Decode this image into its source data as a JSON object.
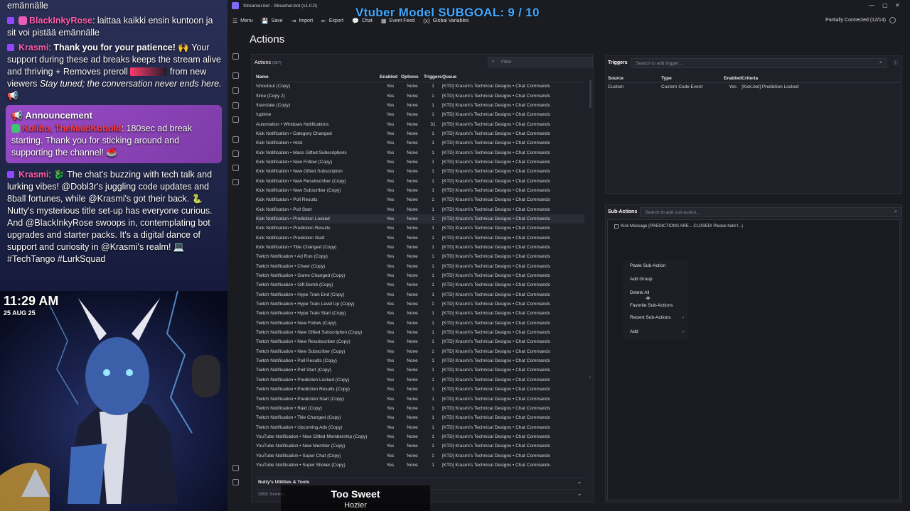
{
  "overlay": {
    "chat": [
      {
        "type": "text",
        "text": "emännälle"
      },
      {
        "type": "msg",
        "user": "BlackInkyRose",
        "user_class": "u-pink",
        "text": ": laittaa kaikki ensin kuntoon ja sit voi pistää emännälle"
      },
      {
        "type": "msg2",
        "user": "Krasmi",
        "user_class": "u-pink",
        "bold": "Thank you for your patience!",
        "text_a": " 🙌 Your support during these ad breaks keeps the stream alive and thriving + Removes preroll ",
        "text_b": " from new viewers ",
        "ital": "Stay tuned; the conversation never ends here.",
        "end": " 📢"
      },
      {
        "type": "announcement",
        "title": "Announcement",
        "user": "Kolibo, TheMaidKobold",
        "text": ": 180sec ad break starting. Thank you for sticking around and supporting the channel! 🥌"
      },
      {
        "type": "msg",
        "user": "Krasmi",
        "user_class": "u-pink",
        "text": ": 🐉 The chat's buzzing with tech talk and lurking vibes! @Dobl3r's juggling code updates and 8ball fortunes, while @Krasmi's got their back. 🐍 Nutty's mysterious title set-up has everyone curious. And @BlackInkyRose swoops in, contemplating bot upgrades and starter packs. It's a digital dance of support and curiosity in @Krasmi's realm! 💻 #TechTango #LurkSquad"
      }
    ],
    "clock": "11:29 AM",
    "date": "25 AUG 25",
    "song_title": "Too Sweet",
    "song_artist": "Hozier"
  },
  "app": {
    "window_title": "Streamer.bot - Streamer.bot (v1.0.0)",
    "subgoal": "Vtuber Model SUBGOAL: 9 / 10",
    "toolbar": [
      {
        "icon": "☰",
        "label": "Menu",
        "name": "menu"
      },
      {
        "icon": "💾",
        "label": "Save",
        "name": "save"
      },
      {
        "icon": "⇥",
        "label": "Import",
        "name": "import"
      },
      {
        "icon": "⇤",
        "label": "Export",
        "name": "export"
      },
      {
        "icon": "💬",
        "label": "Chat",
        "name": "chat"
      },
      {
        "icon": "▦",
        "label": "Event Feed",
        "name": "event-feed"
      },
      {
        "icon": "(x)",
        "label": "Global Variables",
        "name": "global-variables"
      }
    ],
    "connection_status": "Partially Connected (12/14)",
    "page_title": "Actions",
    "actions": {
      "heading": "Actions",
      "count": "(567)",
      "filter_placeholder": "Filter",
      "columns": [
        "Name",
        "Enabled",
        "Options",
        "Triggers",
        "Queue"
      ],
      "rows": [
        [
          "!shoutout (Copy)",
          "Yes",
          "None",
          "1",
          "[KTD] Krasmi's Technical Designs • Chat Commands"
        ],
        [
          "!time (Copy 2)",
          "Yes",
          "None",
          "1",
          "[KTD] Krasmi's Technical Designs • Chat Commands"
        ],
        [
          "!translate (Copy)",
          "Yes",
          "None",
          "1",
          "[KTD] Krasmi's Technical Designs • Chat Commands"
        ],
        [
          "!uptime",
          "Yes",
          "None",
          "1",
          "[KTD] Krasmi's Technical Designs • Chat Commands"
        ],
        [
          "Automation • Windows Notifications",
          "Yes",
          "None",
          "31",
          "[KTD] Krasmi's Technical Designs • Chat Commands"
        ],
        [
          "Kick Notification • Category Changed",
          "Yes",
          "None",
          "1",
          "[KTD] Krasmi's Technical Designs • Chat Commands"
        ],
        [
          "Kick Notification • Host",
          "Yes",
          "None",
          "1",
          "[KTD] Krasmi's Technical Designs • Chat Commands"
        ],
        [
          "Kick Notification • Mass Gifted Subscriptions",
          "Yes",
          "None",
          "1",
          "[KTD] Krasmi's Technical Designs • Chat Commands"
        ],
        [
          "Kick Notification • New Follow (Copy)",
          "Yes",
          "None",
          "1",
          "[KTD] Krasmi's Technical Designs • Chat Commands"
        ],
        [
          "Kick Notification • New Gifted Subscription",
          "Yes",
          "None",
          "1",
          "[KTD] Krasmi's Technical Designs • Chat Commands"
        ],
        [
          "Kick Notification • New Resubscriber (Copy)",
          "Yes",
          "None",
          "1",
          "[KTD] Krasmi's Technical Designs • Chat Commands"
        ],
        [
          "Kick Notification • New Subscriber (Copy)",
          "Yes",
          "None",
          "1",
          "[KTD] Krasmi's Technical Designs • Chat Commands"
        ],
        [
          "Kick Notification • Poll Results",
          "Yes",
          "None",
          "1",
          "[KTD] Krasmi's Technical Designs • Chat Commands"
        ],
        [
          "Kick Notification • Poll Start",
          "Yes",
          "None",
          "1",
          "[KTD] Krasmi's Technical Designs • Chat Commands"
        ],
        [
          "Kick Notification • Prediction Locked",
          "Yes",
          "None",
          "1",
          "[KTD] Krasmi's Technical Designs • Chat Commands"
        ],
        [
          "Kick Notification • Prediction Results",
          "Yes",
          "None",
          "1",
          "[KTD] Krasmi's Technical Designs • Chat Commands"
        ],
        [
          "Kick Notification • Prediction Start",
          "Yes",
          "None",
          "1",
          "[KTD] Krasmi's Technical Designs • Chat Commands"
        ],
        [
          "Kick Notification • Title Changed (Copy)",
          "Yes",
          "None",
          "1",
          "[KTD] Krasmi's Technical Designs • Chat Commands"
        ],
        [
          "Twitch Notification • Ad Run (Copy)",
          "Yes",
          "None",
          "1",
          "[KTD] Krasmi's Technical Designs • Chat Commands"
        ],
        [
          "Twitch Notification • Cheer (Copy)",
          "Yes",
          "None",
          "1",
          "[KTD] Krasmi's Technical Designs • Chat Commands"
        ],
        [
          "Twitch Notification • Game Changed (Copy)",
          "Yes",
          "None",
          "1",
          "[KTD] Krasmi's Technical Designs • Chat Commands"
        ],
        [
          "Twitch Notification • Gift Bomb (Copy)",
          "Yes",
          "None",
          "1",
          "[KTD] Krasmi's Technical Designs • Chat Commands"
        ],
        [
          "Twitch Notification • Hype Train End (Copy)",
          "Yes",
          "None",
          "1",
          "[KTD] Krasmi's Technical Designs • Chat Commands"
        ],
        [
          "Twitch Notification • Hype Train Level Up (Copy)",
          "Yes",
          "None",
          "1",
          "[KTD] Krasmi's Technical Designs • Chat Commands"
        ],
        [
          "Twitch Notification • Hype Train Start (Copy)",
          "Yes",
          "None",
          "1",
          "[KTD] Krasmi's Technical Designs • Chat Commands"
        ],
        [
          "Twitch Notification • New Follow (Copy)",
          "Yes",
          "None",
          "1",
          "[KTD] Krasmi's Technical Designs • Chat Commands"
        ],
        [
          "Twitch Notification • New Gifted Subscription (Copy)",
          "Yes",
          "None",
          "1",
          "[KTD] Krasmi's Technical Designs • Chat Commands"
        ],
        [
          "Twitch Notification • New Resubscriber (Copy)",
          "Yes",
          "None",
          "1",
          "[KTD] Krasmi's Technical Designs • Chat Commands"
        ],
        [
          "Twitch Notification • New Subscriber (Copy)",
          "Yes",
          "None",
          "1",
          "[KTD] Krasmi's Technical Designs • Chat Commands"
        ],
        [
          "Twitch Notification • Poll Results (Copy)",
          "Yes",
          "None",
          "1",
          "[KTD] Krasmi's Technical Designs • Chat Commands"
        ],
        [
          "Twitch Notification • Poll Start (Copy)",
          "Yes",
          "None",
          "1",
          "[KTD] Krasmi's Technical Designs • Chat Commands"
        ],
        [
          "Twitch Notification • Prediction Locked (Copy)",
          "Yes",
          "None",
          "1",
          "[KTD] Krasmi's Technical Designs • Chat Commands"
        ],
        [
          "Twitch Notification • Prediction Results (Copy)",
          "Yes",
          "None",
          "1",
          "[KTD] Krasmi's Technical Designs • Chat Commands"
        ],
        [
          "Twitch Notification • Prediction Start (Copy)",
          "Yes",
          "None",
          "1",
          "[KTD] Krasmi's Technical Designs • Chat Commands"
        ],
        [
          "Twitch Notification • Raid (Copy)",
          "Yes",
          "None",
          "1",
          "[KTD] Krasmi's Technical Designs • Chat Commands"
        ],
        [
          "Twitch Notification • Title Changed (Copy)",
          "Yes",
          "None",
          "1",
          "[KTD] Krasmi's Technical Designs • Chat Commands"
        ],
        [
          "Twitch Notification • Upcoming Ads (Copy)",
          "Yes",
          "None",
          "1",
          "[KTD] Krasmi's Technical Designs • Chat Commands"
        ],
        [
          "YouTube Notification • New Gifted Membership (Copy)",
          "Yes",
          "None",
          "1",
          "[KTD] Krasmi's Technical Designs • Chat Commands"
        ],
        [
          "YouTube Notification • New Member (Copy)",
          "Yes",
          "None",
          "1",
          "[KTD] Krasmi's Technical Designs • Chat Commands"
        ],
        [
          "YouTube Notification • Super Chat (Copy)",
          "Yes",
          "None",
          "1",
          "[KTD] Krasmi's Technical Designs • Chat Commands"
        ],
        [
          "YouTube Notification • Super Sticker (Copy)",
          "Yes",
          "None",
          "1",
          "[KTD] Krasmi's Technical Designs • Chat Commands"
        ]
      ],
      "selected_row": "Kick Notification • Prediction Locked",
      "groups": [
        "Nutty's Utilities & Tools",
        "OBS Scenes"
      ]
    },
    "triggers": {
      "heading": "Triggers",
      "search_placeholder": "Search to add trigger...",
      "columns": [
        "Source",
        "Type",
        "Enabled",
        "Criteria"
      ],
      "rows": [
        [
          "Custom",
          "Custom Code Event",
          "Yes",
          "[Kick.bot] Prediction Locked"
        ]
      ]
    },
    "subactions": {
      "heading": "Sub-Actions",
      "search_placeholder": "Search to add sub-action...",
      "item": "Kick Message (PREDICTIONS ARE... CLOSED! Please hold f...)"
    },
    "context_menu": [
      "Paste Sub-Action",
      "Add Group",
      "Delete All",
      "Favorite Sub-Actions",
      "Recent Sub-Actions",
      "Add"
    ],
    "colors": {
      "accent": "#40a8ff",
      "announcement": "#9a4bc9",
      "twitch": "#9146ff"
    }
  }
}
